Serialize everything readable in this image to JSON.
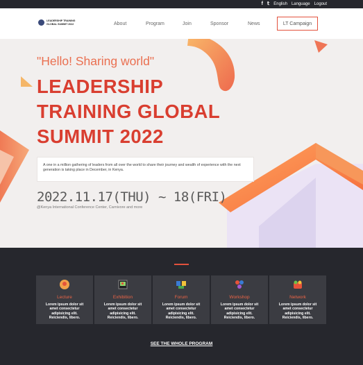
{
  "topbar": {
    "facebook": "f",
    "twitter": "𝕥",
    "english": "English",
    "language": "Language",
    "logout": "Logout"
  },
  "nav": {
    "logo_line1": "LEADERSHIP TRAINING",
    "logo_line2": "GLOBAL SUMMIT 2022",
    "items": [
      "About",
      "Program",
      "Join",
      "Sponsor",
      "News"
    ],
    "cta": "LT Campaign",
    "cta_color": "#e2513c"
  },
  "hero": {
    "greeting": "\"Hello! Sharing world\"",
    "title_line1": "LEADERSHIP",
    "title_line2": "TRAINING GLOBAL",
    "title_line3": "SUMMIT 2022",
    "description": "A one in a million gathering of leaders from all over the world to share their journey and wealth of experience with the next generation is taking place in December, in Kenya.",
    "date": "2022.11.17(THU) ~ 18(FRI)",
    "venue": "@Kenya International Conference Center, Carnivore and more",
    "accent_color": "#d93e30"
  },
  "programs": {
    "items": [
      {
        "title": "Lecture",
        "icon": "lecture-icon",
        "text": "Lorem ipsum dolor sit amet consectetur adipisicing elit. Reiciendis, libero."
      },
      {
        "title": "Exhibition",
        "icon": "exhibition-icon",
        "text": "Lorem ipsum dolor sit amet consectetur adipisicing elit. Reiciendis, libero."
      },
      {
        "title": "Forum",
        "icon": "forum-icon",
        "text": "Lorem ipsum dolor sit amet consectetur adipisicing elit. Reiciendis, libero."
      },
      {
        "title": "Workshop",
        "icon": "workshop-icon",
        "text": "Lorem ipsum dolor sit amet consectetur adipisicing elit. Reiciendis, libero."
      },
      {
        "title": "Network",
        "icon": "network-icon",
        "text": "Lorem ipsum dolor sit amet consectetur adipisicing elit. Reiciendis, libero."
      }
    ],
    "see_all": "SEE THE WHOLE PROGRAM"
  }
}
